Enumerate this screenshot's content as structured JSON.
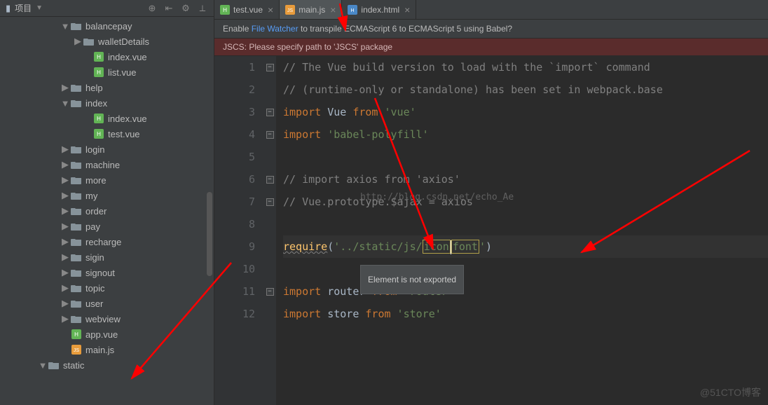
{
  "sidebar": {
    "title": "项目",
    "tree": [
      {
        "indent": 88,
        "arrow": "down",
        "type": "folder",
        "label": "balancepay"
      },
      {
        "indent": 106,
        "arrow": "right",
        "type": "folder",
        "label": "walletDetails"
      },
      {
        "indent": 120,
        "arrow": "",
        "type": "vue",
        "label": "index.vue"
      },
      {
        "indent": 120,
        "arrow": "",
        "type": "vue",
        "label": "list.vue"
      },
      {
        "indent": 88,
        "arrow": "right",
        "type": "folder",
        "label": "help"
      },
      {
        "indent": 88,
        "arrow": "down",
        "type": "folder",
        "label": "index"
      },
      {
        "indent": 120,
        "arrow": "",
        "type": "vue",
        "label": "index.vue"
      },
      {
        "indent": 120,
        "arrow": "",
        "type": "vue",
        "label": "test.vue"
      },
      {
        "indent": 88,
        "arrow": "right",
        "type": "folder",
        "label": "login"
      },
      {
        "indent": 88,
        "arrow": "right",
        "type": "folder",
        "label": "machine"
      },
      {
        "indent": 88,
        "arrow": "right",
        "type": "folder",
        "label": "more"
      },
      {
        "indent": 88,
        "arrow": "right",
        "type": "folder",
        "label": "my"
      },
      {
        "indent": 88,
        "arrow": "right",
        "type": "folder",
        "label": "order"
      },
      {
        "indent": 88,
        "arrow": "right",
        "type": "folder",
        "label": "pay"
      },
      {
        "indent": 88,
        "arrow": "right",
        "type": "folder",
        "label": "recharge"
      },
      {
        "indent": 88,
        "arrow": "right",
        "type": "folder",
        "label": "sigin"
      },
      {
        "indent": 88,
        "arrow": "right",
        "type": "folder",
        "label": "signout"
      },
      {
        "indent": 88,
        "arrow": "right",
        "type": "folder",
        "label": "topic"
      },
      {
        "indent": 88,
        "arrow": "right",
        "type": "folder",
        "label": "user"
      },
      {
        "indent": 88,
        "arrow": "right",
        "type": "folder",
        "label": "webview"
      },
      {
        "indent": 88,
        "arrow": "",
        "type": "vue",
        "label": "app.vue"
      },
      {
        "indent": 88,
        "arrow": "",
        "type": "js",
        "label": "main.js"
      },
      {
        "indent": 56,
        "arrow": "down",
        "type": "folder",
        "label": "static"
      }
    ]
  },
  "tabs": [
    {
      "icon": "vue",
      "label": "test.vue",
      "active": false
    },
    {
      "icon": "js",
      "label": "main.js",
      "active": true
    },
    {
      "icon": "html",
      "label": "index.html",
      "active": false
    }
  ],
  "banners": {
    "filewatcher_pre": "Enable ",
    "filewatcher_link": "File Watcher",
    "filewatcher_post": " to transpile ECMAScript 6 to ECMAScript 5 using Babel?",
    "jscs": "JSCS: Please specify path to 'JSCS' package"
  },
  "code": {
    "line1": "// The Vue build version to load with the `import` command",
    "line2": "// (runtime-only or standalone) has been set in webpack.base",
    "line3_kw1": "import",
    "line3_id": " Vue ",
    "line3_kw2": "from",
    "line3_str": " 'vue'",
    "line4_kw": "import",
    "line4_str": " 'babel-polyfill'",
    "line6": "// import axios from 'axios'",
    "line7": "// Vue.prototype.$ajax = axios",
    "line9_fn": "require",
    "line9_p": "(",
    "line9_s1": "'../static/js/",
    "line9_s2": "icon",
    "line9_s3": "font",
    "line9_s4": "'",
    "line9_p2": ")",
    "line11_kw1": "import",
    "line11_id": " router ",
    "line11_kw2": "from",
    "line11_str": " 'router'",
    "line12_kw1": "import",
    "line12_id": " store ",
    "line12_kw2": "from",
    "line12_str": " 'store'"
  },
  "tooltip": "Element is not exported",
  "watermarks": {
    "csdn": "http://blog.csdn.net/echo_Ae",
    "cto": "@51CTO博客"
  }
}
